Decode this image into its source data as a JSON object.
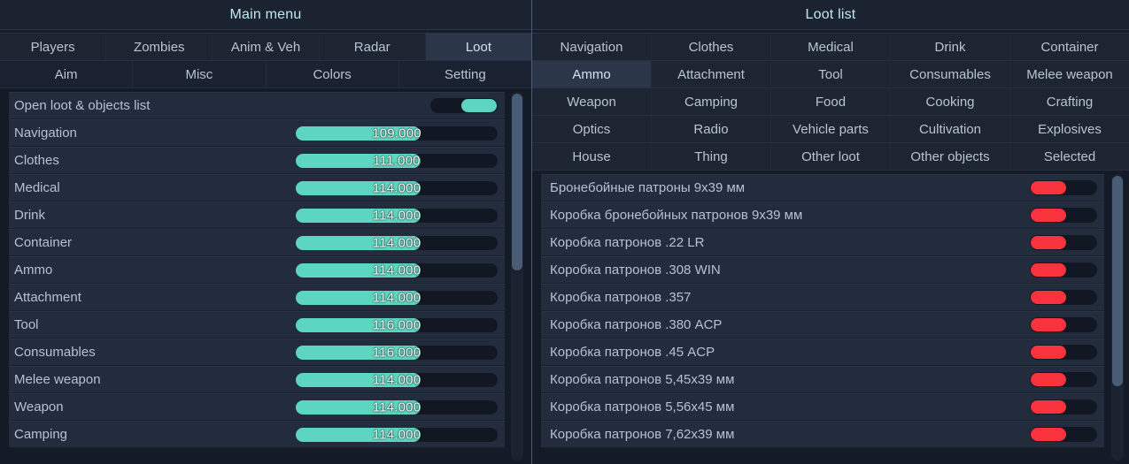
{
  "colors": {
    "accent_teal": "#5cd6c0",
    "accent_red": "#f9333d",
    "panel_bg": "#1b2230",
    "row_bg": "#232c3c",
    "title_text": "#bfe8f2",
    "body_text": "#b6c2d0",
    "tab_active_bg": "#2b3648"
  },
  "left_panel": {
    "title": "Main menu",
    "tabs_row1": [
      {
        "label": "Players",
        "active": false
      },
      {
        "label": "Zombies",
        "active": false
      },
      {
        "label": "Anim & Veh",
        "active": false
      },
      {
        "label": "Radar",
        "active": false
      },
      {
        "label": "Loot",
        "active": true
      }
    ],
    "tabs_row2": [
      {
        "label": "Aim",
        "active": false
      },
      {
        "label": "Misc",
        "active": false
      },
      {
        "label": "Colors",
        "active": false
      },
      {
        "label": "Setting",
        "active": false
      }
    ],
    "rows": [
      {
        "label": "Open loot & objects list",
        "type": "toggle",
        "state": "on"
      },
      {
        "label": "Navigation",
        "type": "slider",
        "value": "109.000",
        "fill_pct": 62
      },
      {
        "label": "Clothes",
        "type": "slider",
        "value": "111.000",
        "fill_pct": 62
      },
      {
        "label": "Medical",
        "type": "slider",
        "value": "114.000",
        "fill_pct": 62
      },
      {
        "label": "Drink",
        "type": "slider",
        "value": "114.000",
        "fill_pct": 62
      },
      {
        "label": "Container",
        "type": "slider",
        "value": "114.000",
        "fill_pct": 62
      },
      {
        "label": "Ammo",
        "type": "slider",
        "value": "114.000",
        "fill_pct": 62
      },
      {
        "label": "Attachment",
        "type": "slider",
        "value": "114.000",
        "fill_pct": 62
      },
      {
        "label": "Tool",
        "type": "slider",
        "value": "116.000",
        "fill_pct": 62
      },
      {
        "label": "Consumables",
        "type": "slider",
        "value": "116.000",
        "fill_pct": 62
      },
      {
        "label": "Melee weapon",
        "type": "slider",
        "value": "114.000",
        "fill_pct": 62
      },
      {
        "label": "Weapon",
        "type": "slider",
        "value": "114.000",
        "fill_pct": 62
      },
      {
        "label": "Camping",
        "type": "slider",
        "value": "114.000",
        "fill_pct": 62
      }
    ]
  },
  "right_panel": {
    "title": "Loot list",
    "tab_grid": [
      [
        {
          "label": "Navigation",
          "active": false
        },
        {
          "label": "Clothes",
          "active": false
        },
        {
          "label": "Medical",
          "active": false
        },
        {
          "label": "Drink",
          "active": false
        },
        {
          "label": "Container",
          "active": false
        }
      ],
      [
        {
          "label": "Ammo",
          "active": true
        },
        {
          "label": "Attachment",
          "active": false
        },
        {
          "label": "Tool",
          "active": false
        },
        {
          "label": "Consumables",
          "active": false
        },
        {
          "label": "Melee weapon",
          "active": false
        }
      ],
      [
        {
          "label": "Weapon",
          "active": false
        },
        {
          "label": "Camping",
          "active": false
        },
        {
          "label": "Food",
          "active": false
        },
        {
          "label": "Cooking",
          "active": false
        },
        {
          "label": "Crafting",
          "active": false
        }
      ],
      [
        {
          "label": "Optics",
          "active": false
        },
        {
          "label": "Radio",
          "active": false
        },
        {
          "label": "Vehicle parts",
          "active": false
        },
        {
          "label": "Cultivation",
          "active": false
        },
        {
          "label": "Explosives",
          "active": false
        }
      ],
      [
        {
          "label": "House",
          "active": false
        },
        {
          "label": "Thing",
          "active": false
        },
        {
          "label": "Other loot",
          "active": false
        },
        {
          "label": "Other objects",
          "active": false
        },
        {
          "label": "Selected",
          "active": false
        }
      ]
    ],
    "items": [
      {
        "label": "Бронебойные патроны 9х39 мм",
        "state": "off"
      },
      {
        "label": "Коробка бронебойных патронов 9х39 мм",
        "state": "off"
      },
      {
        "label": "Коробка патронов .22 LR",
        "state": "off"
      },
      {
        "label": "Коробка патронов .308 WIN",
        "state": "off"
      },
      {
        "label": "Коробка патронов .357",
        "state": "off"
      },
      {
        "label": "Коробка патронов .380 ACP",
        "state": "off"
      },
      {
        "label": "Коробка патронов .45 ACP",
        "state": "off"
      },
      {
        "label": "Коробка патронов 5,45х39 мм",
        "state": "off"
      },
      {
        "label": "Коробка патронов 5,56х45 мм",
        "state": "off"
      },
      {
        "label": "Коробка патронов 7,62х39 мм",
        "state": "off"
      }
    ]
  }
}
